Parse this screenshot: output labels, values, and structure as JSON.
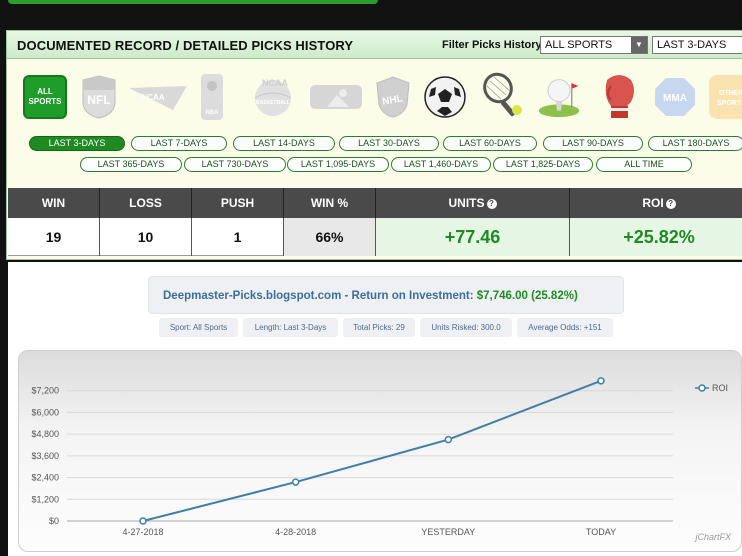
{
  "panel": {
    "title": "DOCUMENTED RECORD / DETAILED PICKS HISTORY",
    "filter_label": "Filter Picks History:",
    "sport_select": "ALL SPORTS",
    "range_select": "LAST 3-DAYS"
  },
  "sports": [
    {
      "label": "ALL SPORTS",
      "icon": "all-sports-icon"
    },
    {
      "label": "NFL",
      "icon": "nfl-logo-icon"
    },
    {
      "label": "NCAA",
      "icon": "ncaa-football-logo-icon"
    },
    {
      "label": "NBA",
      "icon": "nba-logo-icon"
    },
    {
      "label": "NCAA BASKETBALL",
      "icon": "ncaa-basketball-logo-icon"
    },
    {
      "label": "MLB",
      "icon": "mlb-logo-icon"
    },
    {
      "label": "NHL",
      "icon": "nhl-logo-icon"
    },
    {
      "label": "",
      "icon": "soccer-ball-icon"
    },
    {
      "label": "",
      "icon": "tennis-racket-icon"
    },
    {
      "label": "",
      "icon": "golf-ball-icon"
    },
    {
      "label": "",
      "icon": "boxing-glove-icon"
    },
    {
      "label": "MMA",
      "icon": "mma-logo-icon"
    },
    {
      "label": "OTHER SPORTS",
      "icon": "other-sports-icon"
    }
  ],
  "ranges_row1": [
    "LAST 3-DAYS",
    "LAST 7-DAYS",
    "LAST 14-DAYS",
    "LAST 30-DAYS",
    "LAST 60-DAYS",
    "LAST 90-DAYS",
    "LAST 180-DAYS"
  ],
  "ranges_row2": [
    "LAST 365-DAYS",
    "LAST 730-DAYS",
    "LAST 1,095-DAYS",
    "LAST 1,460-DAYS",
    "LAST 1,825-DAYS",
    "ALL TIME"
  ],
  "stats": {
    "headers": [
      "WIN",
      "LOSS",
      "PUSH",
      "WIN %",
      "UNITS",
      "ROI"
    ],
    "values": [
      "19",
      "10",
      "1",
      "66%",
      "+77.46",
      "+25.82%"
    ]
  },
  "summary": {
    "site": "Deepmaster-Picks.blogspot.com - Return on Investment:",
    "amount": "$7,746.00 (25.82%)"
  },
  "tags": [
    "Sport: All Sports",
    "Length: Last 3-Days",
    "Total Picks: 29",
    "Units Risked: 300.0",
    "Average Odds: +151"
  ],
  "colors": {
    "accent": "#1f8a22",
    "header_dark": "#4a4a4a",
    "line": "#3f7fa6"
  },
  "chart_data": {
    "type": "line",
    "categories": [
      "4-27-2018",
      "4-28-2018",
      "YESTERDAY",
      "TODAY"
    ],
    "series": [
      {
        "name": "ROI",
        "values": [
          0,
          2150,
          4500,
          7746
        ]
      }
    ],
    "yticks": [
      "$0",
      "$1,200",
      "$2,400",
      "$3,600",
      "$4,800",
      "$6,000",
      "$7,200"
    ],
    "ylim": [
      0,
      8400
    ],
    "grid": true,
    "legend": "right",
    "watermark": "jChartFX"
  }
}
